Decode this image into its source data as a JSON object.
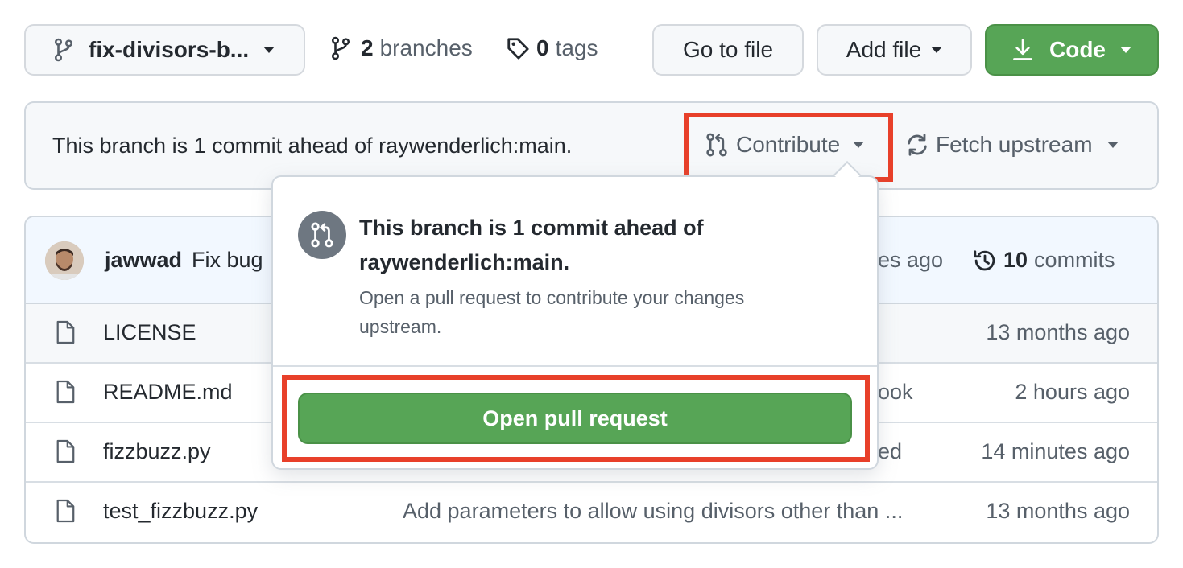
{
  "toolbar": {
    "branch_selector_label": "fix-divisors-b...",
    "branches_count": "2",
    "branches_label": "branches",
    "tags_count": "0",
    "tags_label": "tags",
    "go_to_file_label": "Go to file",
    "add_file_label": "Add file",
    "code_label": "Code"
  },
  "banner": {
    "status_text": "This branch is 1 commit ahead of raywenderlich:main.",
    "contribute_label": "Contribute",
    "fetch_upstream_label": "Fetch upstream"
  },
  "popover": {
    "title": "This branch is 1 commit ahead of raywenderlich:main.",
    "description": "Open a pull request to contribute your changes upstream.",
    "open_pr_label": "Open pull request"
  },
  "latest_commit": {
    "author": "jawwad",
    "message": "Fix bug",
    "time_fragment": "es ago",
    "commits_count": "10",
    "commits_label": "commits"
  },
  "files": [
    {
      "name": "LICENSE",
      "message": "",
      "time": "13 months ago"
    },
    {
      "name": "README.md",
      "message": "ook",
      "time": "2 hours ago"
    },
    {
      "name": "fizzbuzz.py",
      "message": "ed",
      "time": "14 minutes ago"
    },
    {
      "name": "test_fizzbuzz.py",
      "message": "Add parameters to allow using divisors other than ...",
      "time": "13 months ago"
    }
  ],
  "colors": {
    "accent_green": "#57a556",
    "highlight_red": "#e8402a",
    "header_blue": "#f2f8ff"
  }
}
